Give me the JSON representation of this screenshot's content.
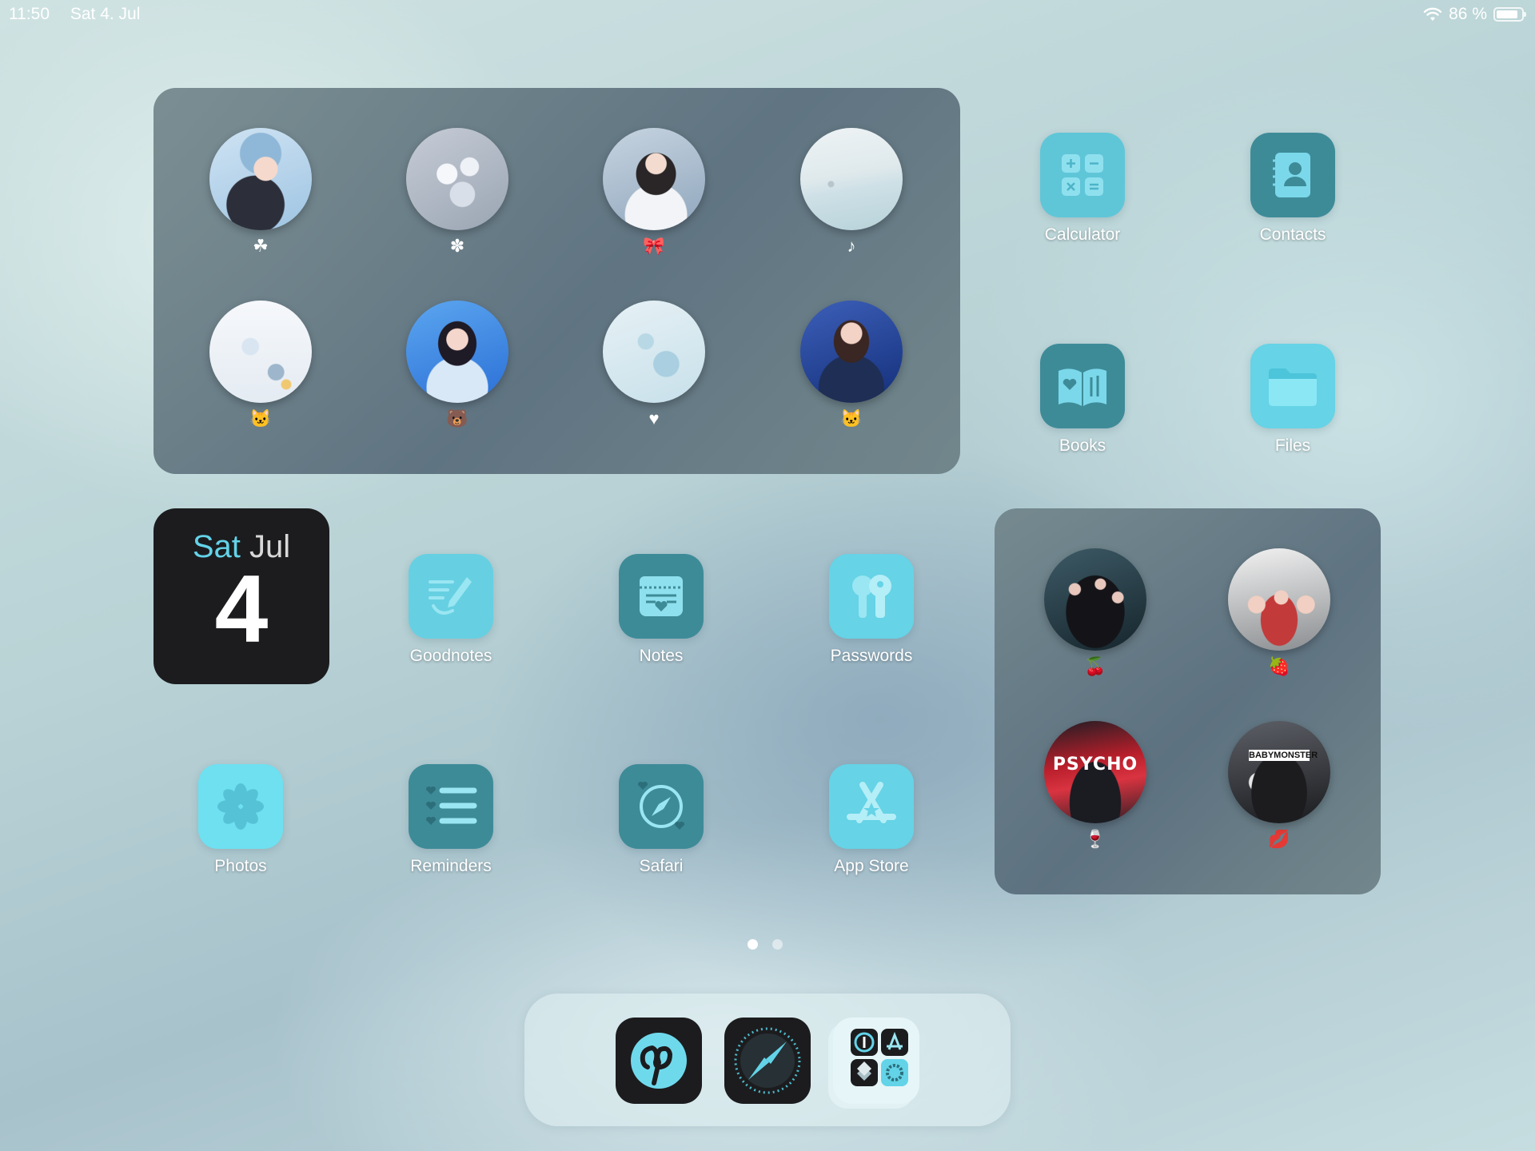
{
  "status": {
    "time": "11:50",
    "date": "Sat 4. Jul",
    "battery": "86 %",
    "battery_level": 0.86
  },
  "widget_top": {
    "photos": [
      {
        "emoji": "☘",
        "scene": "girl-bluehat"
      },
      {
        "emoji": "✽",
        "scene": "flowers"
      },
      {
        "emoji": "🎀",
        "scene": "girl-white"
      },
      {
        "emoji": "♪",
        "scene": "beach"
      },
      {
        "emoji": "🐱",
        "scene": "mobile"
      },
      {
        "emoji": "🐻",
        "scene": "girl-stage"
      },
      {
        "emoji": "♥",
        "scene": "starfish"
      },
      {
        "emoji": "🐱",
        "scene": "girl-navy"
      }
    ]
  },
  "apps": [
    {
      "label": "Calculator",
      "icon": "calculator-icon",
      "color": "#5fc6d8"
    },
    {
      "label": "Contacts",
      "icon": "contacts-icon",
      "color": "#3e8b98"
    },
    {
      "label": "Books",
      "icon": "books-icon",
      "color": "#3e8b98"
    },
    {
      "label": "Files",
      "icon": "folder-icon",
      "color": "#66d3e6"
    },
    {
      "label": "Goodnotes",
      "icon": "goodnotes-icon",
      "color": "#66d0e2"
    },
    {
      "label": "Notes",
      "icon": "notes-icon",
      "color": "#3e8b98"
    },
    {
      "label": "Passwords",
      "icon": "key-icon",
      "color": "#66d3e6"
    },
    {
      "label": "Photos",
      "icon": "photos-icon",
      "color": "#6ee0f0"
    },
    {
      "label": "Reminders",
      "icon": "reminders-icon",
      "color": "#3e8b98"
    },
    {
      "label": "Safari",
      "icon": "compass-icon",
      "color": "#3e8b98"
    },
    {
      "label": "App Store",
      "icon": "appstore-icon",
      "color": "#66d3e6"
    }
  ],
  "calendar": {
    "dow": "Sat",
    "month": "Jul",
    "day": "4"
  },
  "widget_right": {
    "photos": [
      {
        "emoji": "🍒",
        "scene": "group-stage"
      },
      {
        "emoji": "🍓",
        "scene": "group-selfie"
      },
      {
        "emoji": "🍷",
        "scene": "psycho",
        "overlay_text": "PSYCHO"
      },
      {
        "emoji": "💋",
        "scene": "babymonster",
        "overlay_text": "BABYMONSTER"
      }
    ]
  },
  "page_dots": {
    "count": 2,
    "active": 0
  },
  "dock": [
    {
      "icon": "pinterest-icon"
    },
    {
      "icon": "compass-icon"
    },
    {
      "icon": "folder-grid-icon"
    }
  ],
  "colors": {
    "accent": "#63d3e8",
    "teal_dark": "#3e8b98",
    "teal_light": "#66d3e6"
  }
}
